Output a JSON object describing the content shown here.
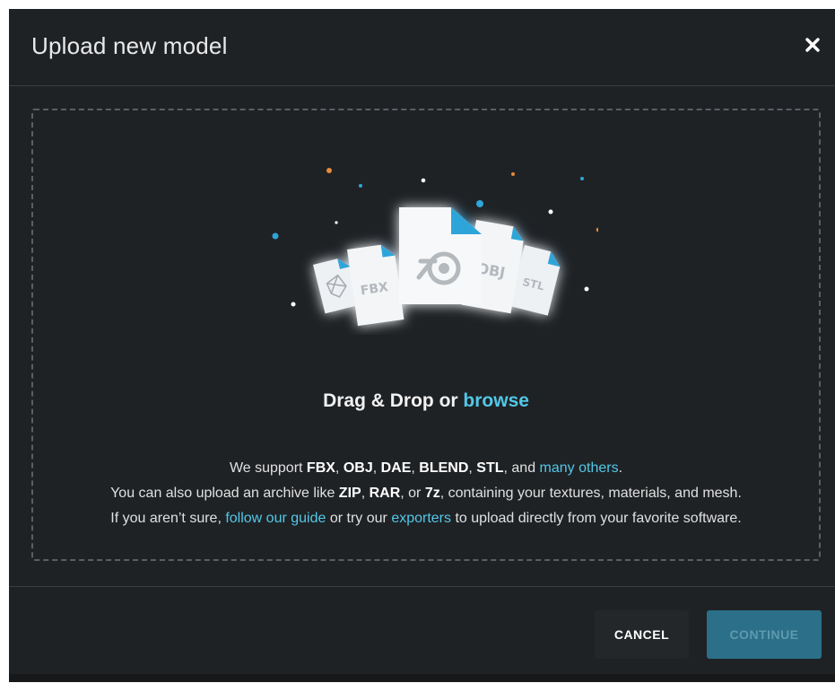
{
  "modal": {
    "title": "Upload new model",
    "close_icon": "close-icon"
  },
  "dropzone": {
    "file_types_illustrated": [
      "FBX",
      "OBJ",
      "STL"
    ],
    "drag_text": "Drag & Drop or ",
    "browse_link": "browse",
    "line1": {
      "prefix": "We support ",
      "fmt1": "FBX",
      "sep1": ", ",
      "fmt2": "OBJ",
      "sep2": ", ",
      "fmt3": "DAE",
      "sep3": ", ",
      "fmt4": "BLEND",
      "sep4": ", ",
      "fmt5": "STL",
      "sep5": ", and ",
      "link": "many others",
      "suffix": "."
    },
    "line2": {
      "prefix": "You can also upload an archive like ",
      "fmt1": "ZIP",
      "sep1": ", ",
      "fmt2": "RAR",
      "sep2": ", or ",
      "fmt3": "7z",
      "suffix": ", containing your textures, materials, and mesh."
    },
    "line3": {
      "prefix": "If you aren’t sure, ",
      "link1": "follow our guide",
      "mid": " or try our ",
      "link2": "exporters",
      "suffix": " to upload directly from your favorite software."
    }
  },
  "footer": {
    "cancel_label": "CANCEL",
    "continue_label": "CONTINUE"
  },
  "colors": {
    "background": "#1f2225",
    "link": "#52c8e8",
    "continue_button": "#2b6f88",
    "file_corner": "#2fa5d8",
    "particle_orange": "#e8893a"
  }
}
